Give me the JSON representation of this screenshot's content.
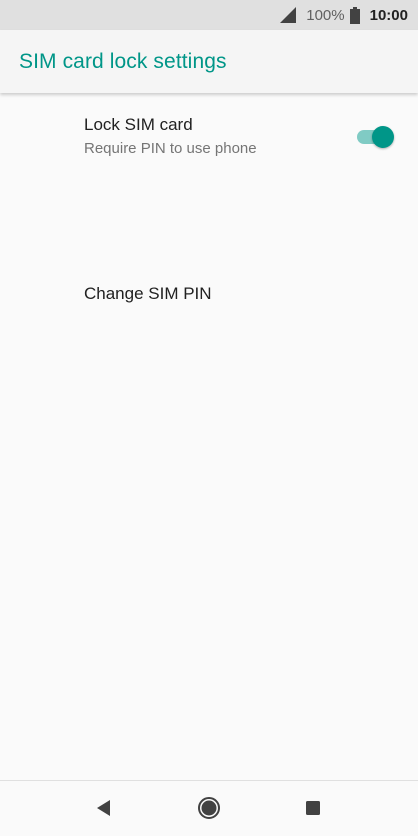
{
  "status_bar": {
    "battery_percent": "100%",
    "time": "10:00",
    "icons": [
      "signal-icon",
      "battery-icon"
    ]
  },
  "toolbar": {
    "title": "SIM card lock settings"
  },
  "settings": {
    "items": [
      {
        "title": "Lock SIM card",
        "summary": "Require PIN to use phone",
        "toggle_on": true
      },
      {
        "title": "Change SIM PIN"
      }
    ]
  },
  "nav_bar": {
    "icons": [
      "back-icon",
      "home-icon",
      "recents-icon"
    ]
  },
  "colors": {
    "accent": "#009688",
    "toggle_track": "#80cbc4",
    "status_bar_bg": "#e0e0e0",
    "background": "#fafafa"
  }
}
